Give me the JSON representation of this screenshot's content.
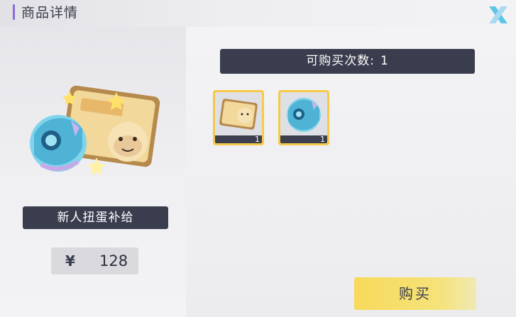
{
  "header": {
    "title": "商品详情",
    "close_icon": "close-x-icon"
  },
  "product": {
    "name": "新人扭蛋补给",
    "currency_symbol": "¥",
    "price": "128",
    "hero_items": [
      "gacha-capsule",
      "dog-ticket"
    ]
  },
  "purchase": {
    "count_label": "可购买次数:",
    "count_value": "1"
  },
  "items": [
    {
      "icon": "dog-ticket-icon",
      "quantity": "1"
    },
    {
      "icon": "gacha-capsule-icon",
      "quantity": "1"
    }
  ],
  "buy_button": {
    "label": "购买"
  },
  "colors": {
    "accent": "#8a6bdc",
    "dark_plate": "#3a3d4e",
    "slot_border": "#f6c948",
    "button": "#f7da5a",
    "close_icon": "#5bc6e8"
  }
}
